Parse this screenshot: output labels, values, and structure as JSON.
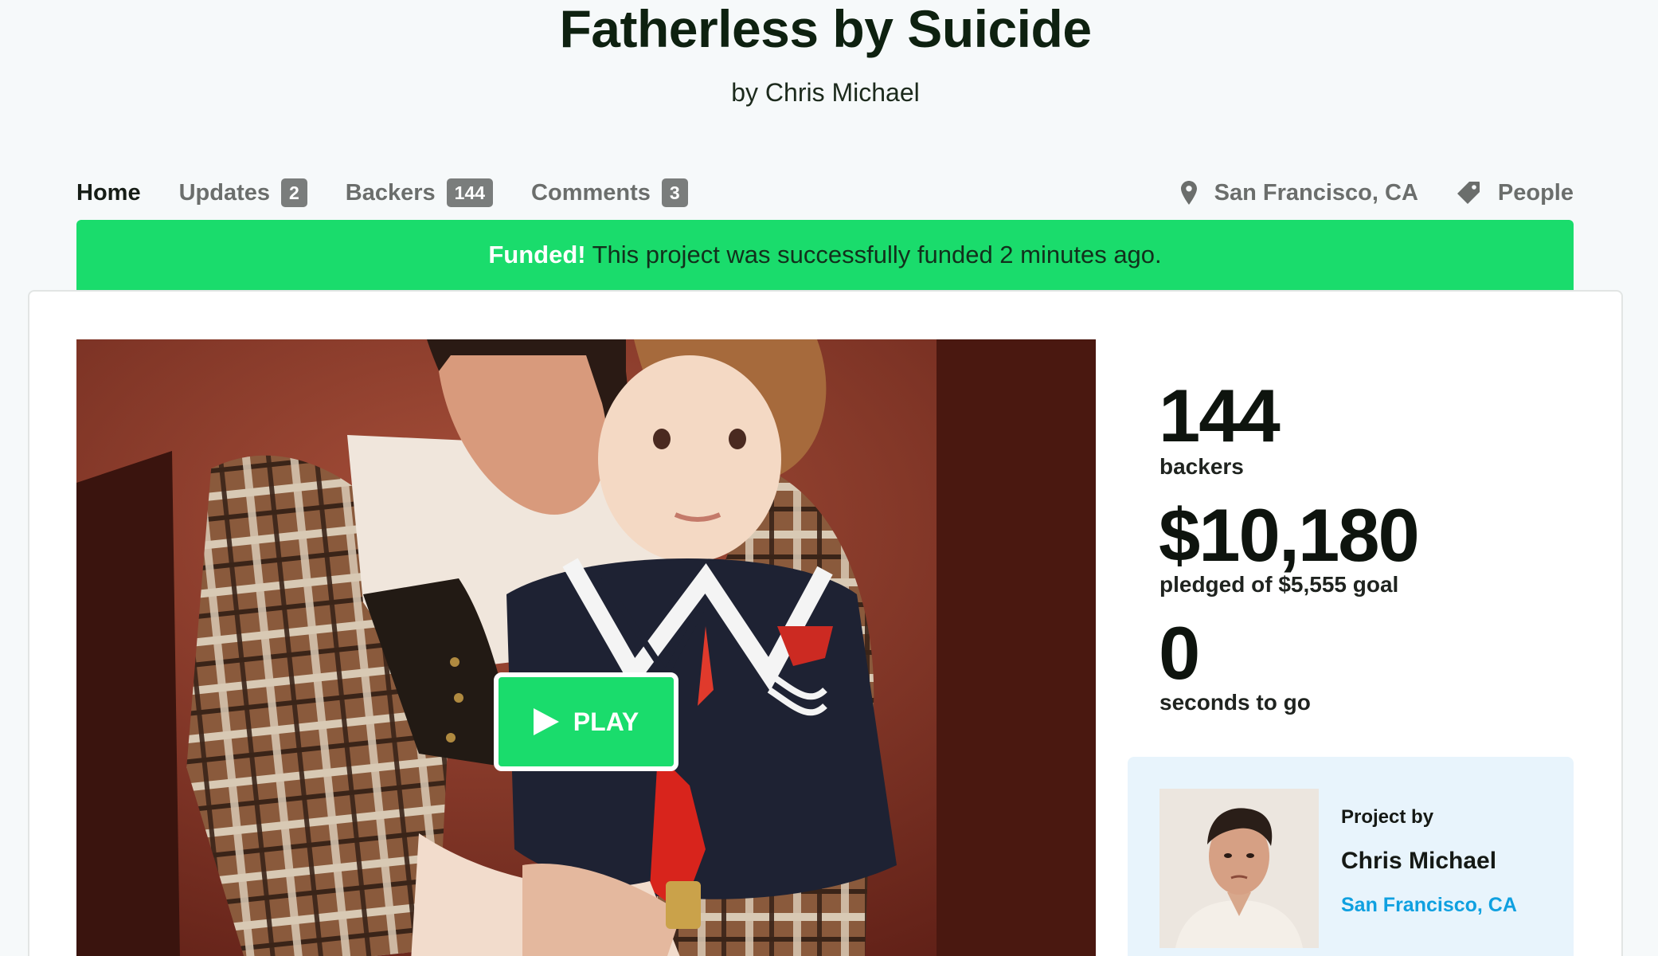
{
  "project": {
    "title": "Fatherless by Suicide",
    "byline": "by Chris Michael"
  },
  "nav": {
    "home": "Home",
    "updates": {
      "label": "Updates",
      "count": "2"
    },
    "backers": {
      "label": "Backers",
      "count": "144"
    },
    "comments": {
      "label": "Comments",
      "count": "3"
    },
    "location": "San Francisco, CA",
    "category": "People"
  },
  "banner": {
    "strong": "Funded!",
    "text": "This project was successfully funded 2 minutes ago."
  },
  "video": {
    "play_label": "PLAY"
  },
  "stats": {
    "backers_count": "144",
    "backers_label": "backers",
    "pledged": "$10,180",
    "pledged_label": "pledged of $5,555 goal",
    "time_left": "0",
    "time_label": "seconds to go"
  },
  "creator": {
    "heading": "Project by",
    "name": "Chris Michael",
    "location": "San Francisco, CA"
  },
  "colors": {
    "accent": "#1adc6c",
    "link": "#0fa0e0"
  }
}
